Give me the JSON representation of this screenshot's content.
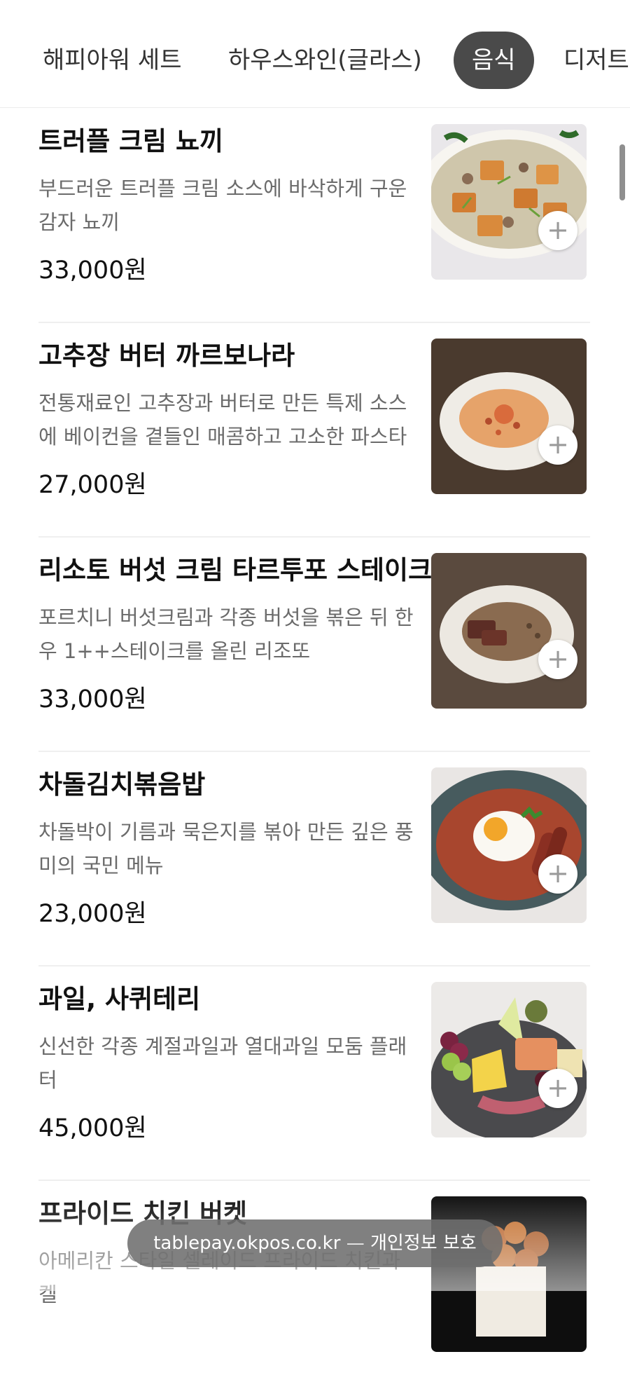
{
  "tabs": [
    {
      "label": "해피아워 세트",
      "active": false
    },
    {
      "label": "하우스와인(글라스)",
      "active": false
    },
    {
      "label": "음식",
      "active": true
    },
    {
      "label": "디저트",
      "active": false
    }
  ],
  "menu_items": [
    {
      "name": "트러플 크림 뇨끼",
      "description": "부드러운 트러플 크림 소스에 바삭하게 구운 감자 뇨끼",
      "price": "33,000원",
      "add_label": "+"
    },
    {
      "name": "고추장 버터 까르보나라",
      "description": "전통재료인 고추장과 버터로 만든 특제 소스에 베이컨을 곁들인 매콤하고 고소한 파스타",
      "price": "27,000원",
      "add_label": "+"
    },
    {
      "name": "리소토 버섯 크림 타르투포 스테이크",
      "description": "포르치니 버섯크림과 각종 버섯을 볶은 뒤 한우 1++스테이크를 올린 리조또",
      "price": "33,000원",
      "add_label": "+"
    },
    {
      "name": "차돌김치볶음밥",
      "description": "차돌박이 기름과 묵은지를 볶아 만든 깊은 풍미의 국민 메뉴",
      "price": "23,000원",
      "add_label": "+"
    },
    {
      "name": "과일, 사퀴테리",
      "description": "신선한 각종 계절과일과 열대과일 모둠 플래터",
      "price": "45,000원",
      "add_label": "+"
    },
    {
      "name": "프라이드 치킨 버켓",
      "description": "아메리칸 스타일 셀레이드 프라이드 치킨과 켈",
      "price": "",
      "add_label": "+"
    }
  ],
  "url_bar": {
    "domain": "tablepay.okpos.co.kr",
    "separator": "—",
    "label": "개인정보 보호"
  }
}
